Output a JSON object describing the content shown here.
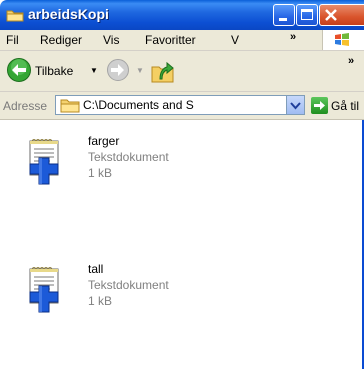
{
  "window": {
    "title": "arbeidsKopi"
  },
  "menu": {
    "items": [
      "Fil",
      "Rediger",
      "Vis",
      "Favoritter",
      "V"
    ],
    "overflow": "»"
  },
  "toolbar": {
    "back_label": "Tilbake",
    "overflow": "»"
  },
  "address": {
    "label": "Adresse",
    "value": "C:\\Documents and S",
    "go_label": "Gå til"
  },
  "files": [
    {
      "name": "farger",
      "type": "Tekstdokument",
      "size": "1 kB"
    },
    {
      "name": "tall",
      "type": "Tekstdokument",
      "size": "1 kB"
    }
  ],
  "colors": {
    "titlebar": "#0c4fd3",
    "chrome": "#ece9d8",
    "close": "#d9542c",
    "accent_green": "#2a9a2a"
  }
}
